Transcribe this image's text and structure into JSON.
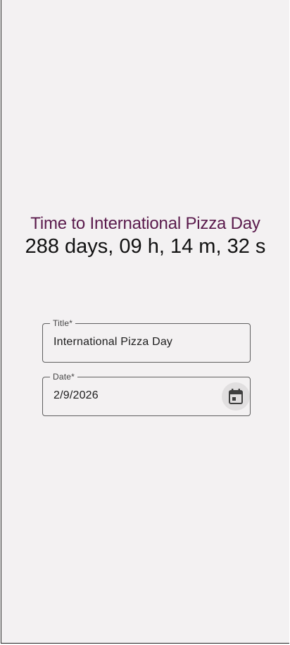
{
  "countdown": {
    "headline": "Time to International Pizza Day",
    "remaining": "288 days, 09 h, 14 m, 32 s"
  },
  "form": {
    "title_field": {
      "label": "Title*",
      "value": "International Pizza Day"
    },
    "date_field": {
      "label": "Date*",
      "value": "2/9/2026",
      "icon": "calendar-icon"
    }
  },
  "colors": {
    "background": "#f3f1f2",
    "headline": "#5a1a4c",
    "outline": "#5f5f5f"
  }
}
